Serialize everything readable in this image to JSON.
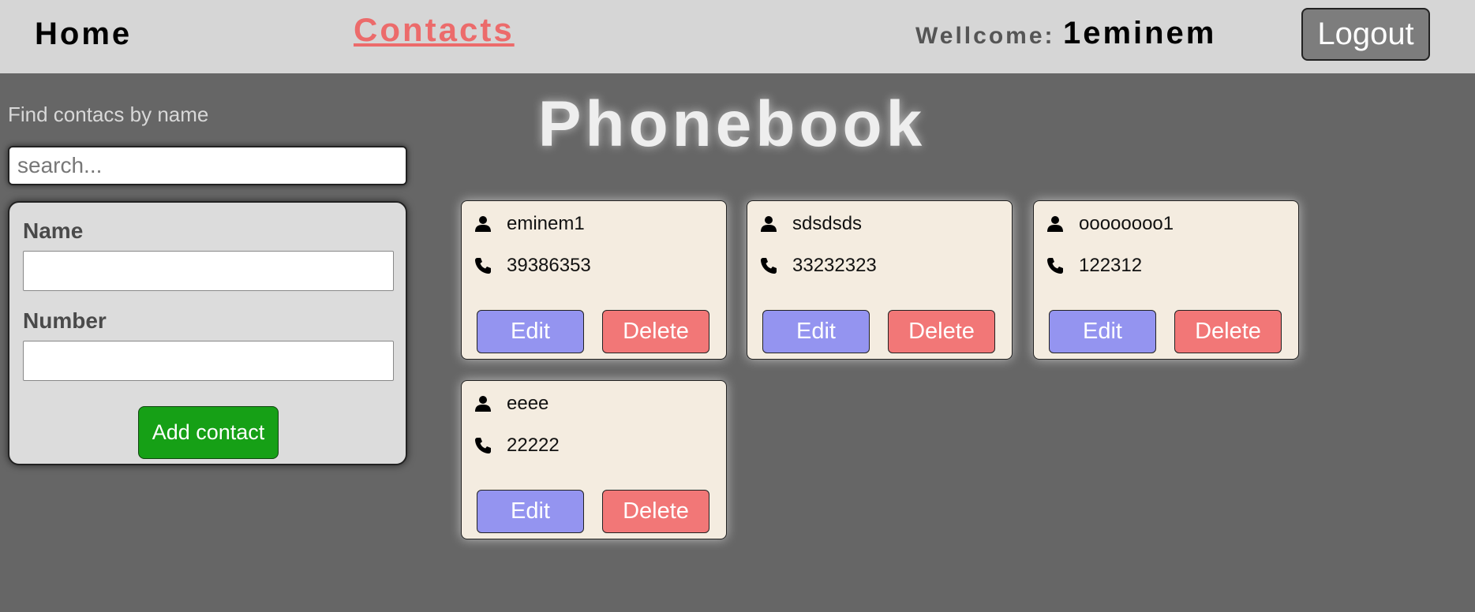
{
  "header": {
    "home_label": "Home",
    "contacts_label": "Contacts",
    "welcome_label": "Wellcome:",
    "username": "1eminem",
    "logout_label": "Logout"
  },
  "page": {
    "title": "Phonebook"
  },
  "search": {
    "label": "Find contacs by name",
    "placeholder": "search...",
    "value": ""
  },
  "form": {
    "name_label": "Name",
    "name_value": "",
    "number_label": "Number",
    "number_value": "",
    "submit_label": "Add contact"
  },
  "contacts": [
    {
      "name": "eminem1",
      "number": "39386353",
      "edit_label": "Edit",
      "delete_label": "Delete"
    },
    {
      "name": "sdsdsds",
      "number": "33232323",
      "edit_label": "Edit",
      "delete_label": "Delete"
    },
    {
      "name": "oooooooo1",
      "number": "122312",
      "edit_label": "Edit",
      "delete_label": "Delete"
    },
    {
      "name": "eeee",
      "number": "22222",
      "edit_label": "Edit",
      "delete_label": "Delete"
    }
  ],
  "icons": {
    "person": "user-icon",
    "phone": "phone-icon"
  },
  "colors": {
    "background": "#666666",
    "header": "#d6d6d6",
    "contacts_link": "#ec6b6b",
    "card": "#f4ece0",
    "edit_button": "#9494f0",
    "delete_button": "#f27777",
    "add_button": "#16a016",
    "logout_button": "#7d7d7d"
  }
}
